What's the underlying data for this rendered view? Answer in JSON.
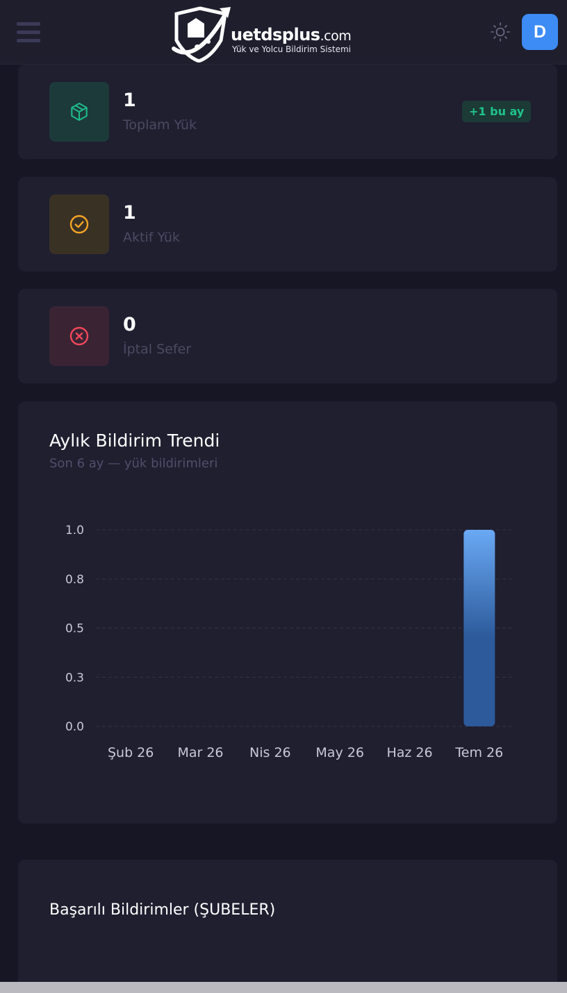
{
  "header": {
    "brand_name": "uetdsplus",
    "brand_domain": ".com",
    "brand_tagline": "Yük ve Yolcu Bildirim Sistemi",
    "avatar_initial": "D",
    "menu_icon": "hamburger-icon",
    "theme_icon": "sun-icon"
  },
  "stats": [
    {
      "value": "1",
      "label": "Toplam Yük",
      "icon": "box-icon",
      "color": "#1fb98a",
      "icon_bg": "#1c3a3a",
      "badge": "+1 bu ay"
    },
    {
      "value": "1",
      "label": "Aktif Yük",
      "icon": "check-circle-icon",
      "color": "#f5a524",
      "icon_bg": "#3a3125"
    },
    {
      "value": "0",
      "label": "İptal Sefer",
      "icon": "x-circle-icon",
      "color": "#f0475c",
      "icon_bg": "#3a2433"
    }
  ],
  "trend_card": {
    "title": "Aylık Bildirim Trendi",
    "subtitle": "Son 6 ay — yük bildirimleri"
  },
  "chart_data": {
    "type": "bar",
    "categories": [
      "Şub 26",
      "Mar 26",
      "Nis 26",
      "May 26",
      "Haz 26",
      "Tem 26"
    ],
    "values": [
      0,
      0,
      0,
      0,
      0,
      1
    ],
    "ylim": [
      0,
      1
    ],
    "yticks": [
      "0.0",
      "0.3",
      "0.5",
      "0.8",
      "1.0"
    ],
    "ytick_values": [
      0,
      0.25,
      0.5,
      0.75,
      1.0
    ],
    "grid": true,
    "bar_color_top": "#6aa9f5",
    "bar_color_bottom": "#2c5a9a"
  },
  "branches_card": {
    "title": "Başarılı Bildirimler (ŞUBELER)"
  }
}
